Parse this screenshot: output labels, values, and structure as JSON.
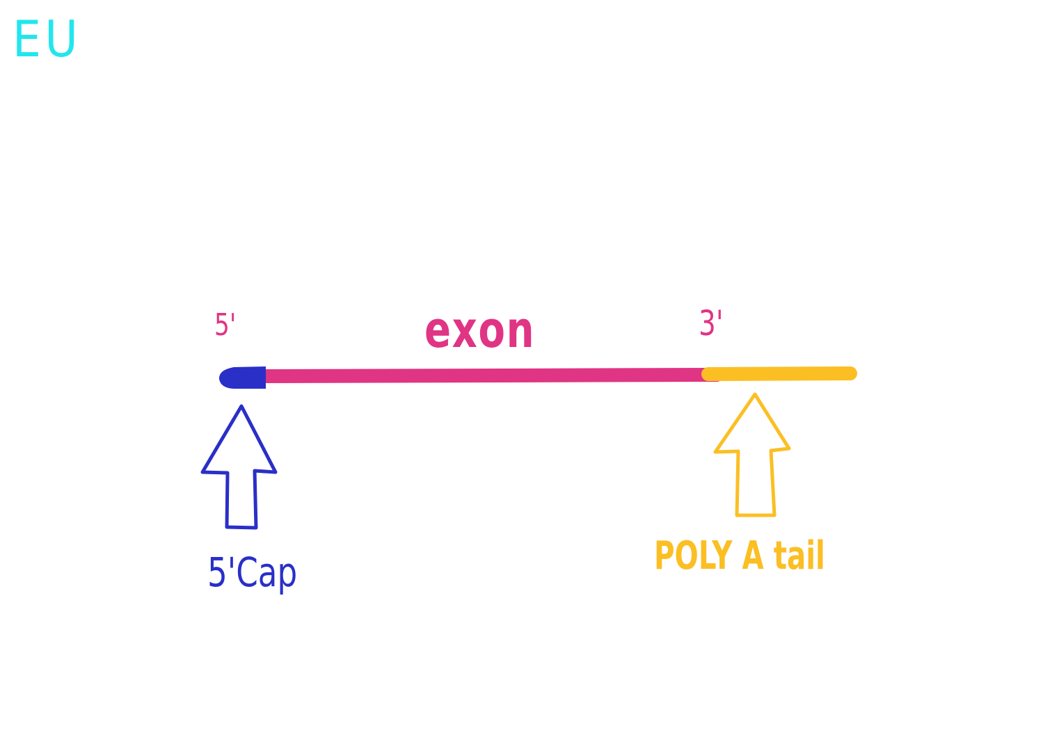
{
  "corner_tag": "EU",
  "labels": {
    "five_prime": "5'",
    "exon": "exon",
    "three_prime": "3'",
    "cap": "5'Cap",
    "poly_a_tail": "POLY A tail"
  },
  "colors": {
    "tag": "#22e6ee",
    "exon": "#e03484",
    "cap": "#2a2fc8",
    "tail": "#fbbf24"
  }
}
